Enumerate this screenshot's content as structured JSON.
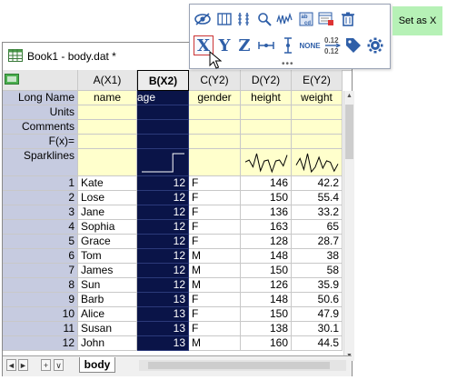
{
  "window": {
    "title": "Book1 - body.dat *"
  },
  "columns": [
    {
      "header": "A(X1)",
      "long_name": "name"
    },
    {
      "header": "B(X2)",
      "long_name": "age"
    },
    {
      "header": "C(Y2)",
      "long_name": "gender"
    },
    {
      "header": "D(Y2)",
      "long_name": "height"
    },
    {
      "header": "E(Y2)",
      "long_name": "weight"
    }
  ],
  "meta_rows": [
    "Long Name",
    "Units",
    "Comments",
    "F(x)=",
    "Sparklines"
  ],
  "rows": [
    {
      "n": "1",
      "name": "Kate",
      "age": "12",
      "gender": "F",
      "height": "146",
      "weight": "42.2"
    },
    {
      "n": "2",
      "name": "Lose",
      "age": "12",
      "gender": "F",
      "height": "150",
      "weight": "55.4"
    },
    {
      "n": "3",
      "name": "Jane",
      "age": "12",
      "gender": "F",
      "height": "136",
      "weight": "33.2"
    },
    {
      "n": "4",
      "name": "Sophia",
      "age": "12",
      "gender": "F",
      "height": "163",
      "weight": "65"
    },
    {
      "n": "5",
      "name": "Grace",
      "age": "12",
      "gender": "F",
      "height": "128",
      "weight": "28.7"
    },
    {
      "n": "6",
      "name": "Tom",
      "age": "12",
      "gender": "M",
      "height": "148",
      "weight": "38"
    },
    {
      "n": "7",
      "name": "James",
      "age": "12",
      "gender": "M",
      "height": "150",
      "weight": "58"
    },
    {
      "n": "8",
      "name": "Sun",
      "age": "12",
      "gender": "M",
      "height": "126",
      "weight": "35.9"
    },
    {
      "n": "9",
      "name": "Barb",
      "age": "13",
      "gender": "F",
      "height": "148",
      "weight": "50.6"
    },
    {
      "n": "10",
      "name": "Alice",
      "age": "13",
      "gender": "F",
      "height": "150",
      "weight": "47.9"
    },
    {
      "n": "11",
      "name": "Susan",
      "age": "13",
      "gender": "F",
      "height": "138",
      "weight": "30.1"
    },
    {
      "n": "12",
      "name": "John",
      "age": "13",
      "gender": "M",
      "height": "160",
      "weight": "44.5"
    }
  ],
  "sheet_tab": "body",
  "tab_buttons": [
    "◄",
    "►",
    "+",
    "∨"
  ],
  "toolbar": {
    "x_label": "X",
    "y_label": "Y",
    "z_label": "Z",
    "none_label": "NONE",
    "tooltip": "Set as X"
  },
  "colors": {
    "selection": "#0a1448",
    "row_header": "#c6cbe0",
    "meta_bg": "#ffffcc",
    "tooltip_bg": "#b6f1b6",
    "accent": "#2f5fa8"
  }
}
